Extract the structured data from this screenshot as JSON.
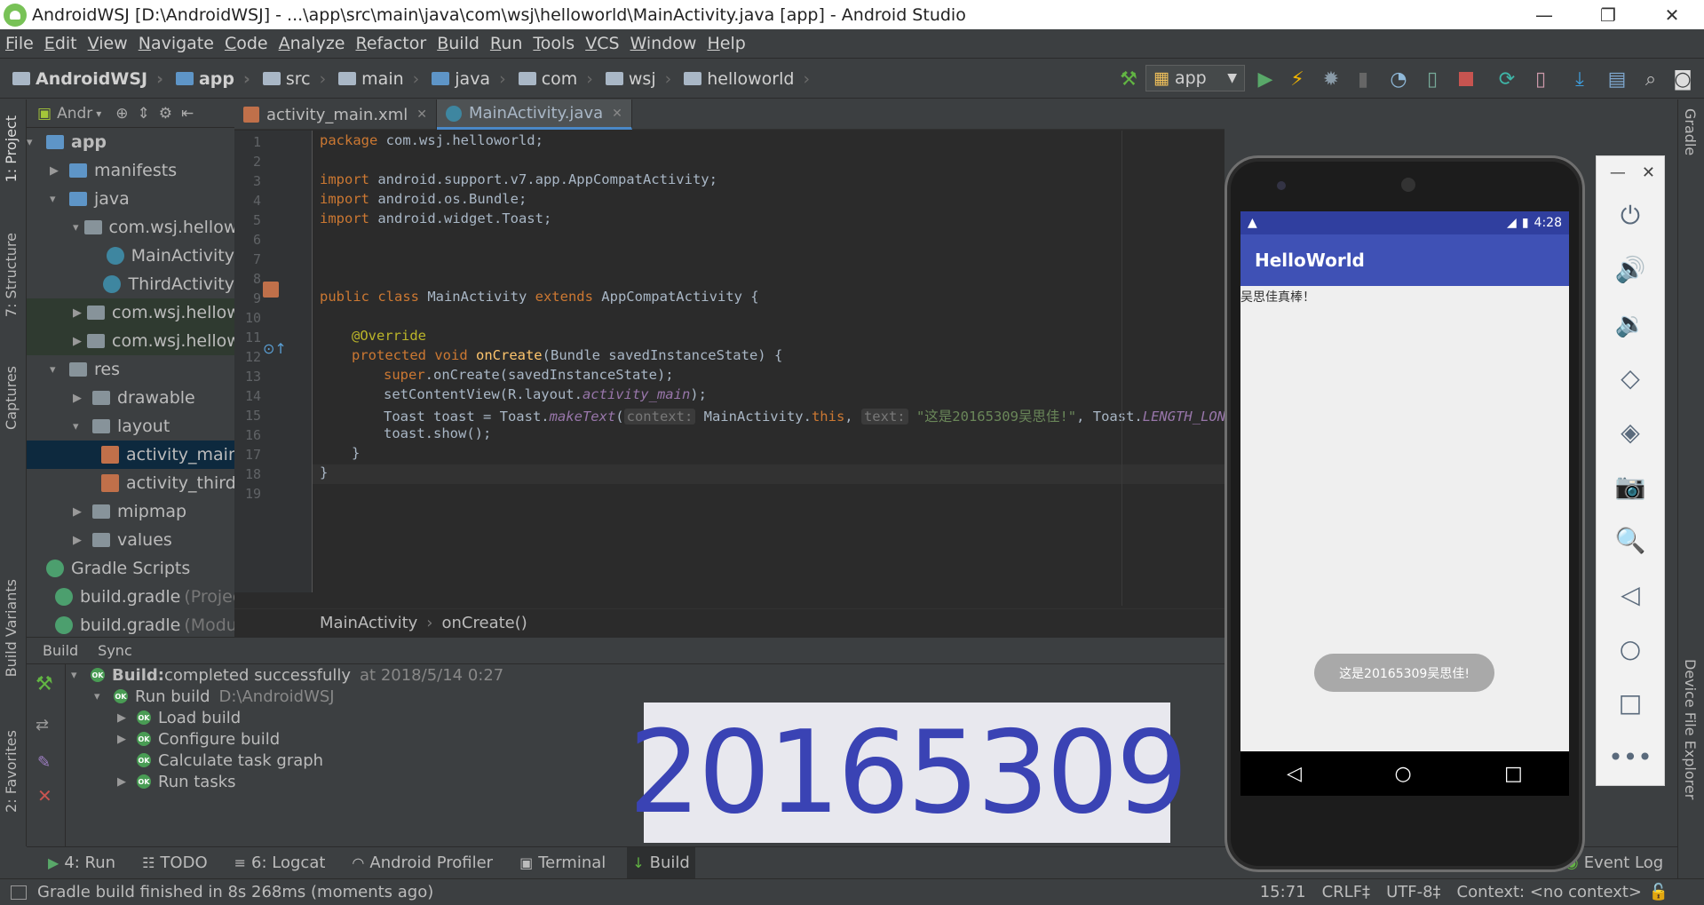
{
  "window": {
    "title": "AndroidWSJ [D:\\AndroidWSJ] - ...\\app\\src\\main\\java\\com\\wsj\\helloworld\\MainActivity.java [app] - Android Studio",
    "controls": [
      "—",
      "❐",
      "✕"
    ]
  },
  "menu": [
    "File",
    "Edit",
    "View",
    "Navigate",
    "Code",
    "Analyze",
    "Refactor",
    "Build",
    "Run",
    "Tools",
    "VCS",
    "Window",
    "Help"
  ],
  "breadcrumb": [
    "AndroidWSJ",
    "app",
    "src",
    "main",
    "java",
    "com",
    "wsj",
    "helloworld"
  ],
  "run_config": "app",
  "project_panel": {
    "header": "Andr",
    "tree": [
      {
        "label": "app",
        "indent": 0,
        "arrow": "▾",
        "icon": "folder-blue",
        "bold": true
      },
      {
        "label": "manifests",
        "indent": 1,
        "arrow": "▶",
        "icon": "folder-blue"
      },
      {
        "label": "java",
        "indent": 1,
        "arrow": "▾",
        "icon": "folder-blue"
      },
      {
        "label": "com.wsj.hellowor",
        "indent": 2,
        "arrow": "▾",
        "icon": "folder"
      },
      {
        "label": "MainActivity",
        "indent": 3,
        "arrow": "",
        "icon": "class"
      },
      {
        "label": "ThirdActivity",
        "indent": 3,
        "arrow": "",
        "icon": "class"
      },
      {
        "label": "com.wsj.hellowor",
        "indent": 2,
        "arrow": "▶",
        "icon": "folder",
        "highlight": true
      },
      {
        "label": "com.wsj.hellowor",
        "indent": 2,
        "arrow": "▶",
        "icon": "folder",
        "highlight": true
      },
      {
        "label": "res",
        "indent": 1,
        "arrow": "▾",
        "icon": "folder"
      },
      {
        "label": "drawable",
        "indent": 2,
        "arrow": "▶",
        "icon": "folder"
      },
      {
        "label": "layout",
        "indent": 2,
        "arrow": "▾",
        "icon": "folder"
      },
      {
        "label": "activity_main.",
        "indent": 3,
        "arrow": "",
        "icon": "xml",
        "selected": true
      },
      {
        "label": "activity_third.",
        "indent": 3,
        "arrow": "",
        "icon": "xml"
      },
      {
        "label": "mipmap",
        "indent": 2,
        "arrow": "▶",
        "icon": "folder"
      },
      {
        "label": "values",
        "indent": 2,
        "arrow": "▶",
        "icon": "folder"
      },
      {
        "label": "Gradle Scripts",
        "indent": 0,
        "arrow": "",
        "icon": "gradle"
      },
      {
        "label": "build.gradle",
        "muted": "(Project",
        "indent": 1,
        "arrow": "",
        "icon": "gradle"
      },
      {
        "label": "build.gradle",
        "muted": "(Module",
        "indent": 1,
        "arrow": "",
        "icon": "gradle"
      }
    ]
  },
  "left_tabs": [
    "1: Project",
    "7: Structure",
    "Captures",
    "Build Variants",
    "2: Favorites"
  ],
  "right_tabs": [
    "Gradle",
    "Device File Explorer"
  ],
  "editor": {
    "tabs": [
      {
        "label": "activity_main.xml",
        "active": false
      },
      {
        "label": "MainActivity.java",
        "active": true
      }
    ],
    "line_numbers": [
      "1",
      "2",
      "3",
      "4",
      "5",
      "6",
      "7",
      "8",
      "9",
      "10",
      "11",
      "12",
      "13",
      "14",
      "15",
      "16",
      "17",
      "18",
      "19"
    ],
    "code": {
      "l1_kw": "package",
      "l1_rest": " com.wsj.helloworld;",
      "l3_kw": "import",
      "l3_rest": " android.support.v7.app.AppCompatActivity;",
      "l4_kw": "import",
      "l4_rest": " android.os.Bundle;",
      "l5_kw": "import",
      "l5_rest": " android.widget.Toast;",
      "l9_kw1": "public class",
      "l9_a": " MainActivity ",
      "l9_kw2": "extends",
      "l9_b": " AppCompatActivity {",
      "l11": "@Override",
      "l12_kw": "protected void",
      "l12_fn": " onCreate",
      "l12_rest": "(Bundle savedInstanceState) {",
      "l13_kw": "super",
      "l13_rest": ".onCreate(savedInstanceState);",
      "l14_a": "setContentView(R.layout.",
      "l14_it": "activity_main",
      "l14_b": ");",
      "l15_a": "Toast toast = Toast.",
      "l15_it": "makeText",
      "l15_b": "(",
      "l15_hint1": "context:",
      "l15_c": " MainActivity.",
      "l15_kw": "this",
      "l15_d": ", ",
      "l15_hint2": "text:",
      "l15_str": " \"这是20165309吴思佳!\"",
      "l15_e": ", Toast.",
      "l15_it2": "LENGTH_LONG",
      "l15_f": ");",
      "l16": "toast.show();",
      "l17": "}",
      "l18": "}"
    },
    "breadcrumb": [
      "MainActivity",
      "onCreate()"
    ]
  },
  "build_panel": {
    "tabs": [
      "Build",
      "Sync"
    ],
    "rows": [
      {
        "label": "Build:",
        "label2": " completed successfully",
        "muted": "at 2018/5/14 0:27",
        "indent": 0,
        "arrow": "▾",
        "bold": true
      },
      {
        "label": "Run build",
        "muted": "D:\\AndroidWSJ",
        "indent": 1,
        "arrow": "▾"
      },
      {
        "label": "Load build",
        "indent": 2,
        "arrow": "▶"
      },
      {
        "label": "Configure build",
        "indent": 2,
        "arrow": "▶"
      },
      {
        "label": "Calculate task graph",
        "indent": 2,
        "arrow": ""
      },
      {
        "label": "Run tasks",
        "indent": 2,
        "arrow": "▶"
      }
    ],
    "ok_badge": "OK"
  },
  "overlay_number": "20165309",
  "tool_tabs": [
    {
      "label": "4: Run",
      "icon": "▶",
      "active": false
    },
    {
      "label": "TODO",
      "icon": "☷",
      "active": false
    },
    {
      "label": "6: Logcat",
      "icon": "≡",
      "active": false
    },
    {
      "label": "Android Profiler",
      "icon": "◠",
      "active": false
    },
    {
      "label": "Terminal",
      "icon": "▣",
      "active": false
    },
    {
      "label": "Build",
      "icon": "↓",
      "active": true
    }
  ],
  "event_log": "Event Log",
  "status": {
    "message": "Gradle build finished in 8s 268ms (moments ago)",
    "position": "15:71",
    "line_sep": "CRLF‡",
    "encoding": "UTF-8‡",
    "context": "Context: <no context>"
  },
  "emulator": {
    "time": "4:28",
    "app_title": "HelloWorld",
    "text": "吴思佳真棒！",
    "toast": "这是20165309吴思佳!",
    "nav": [
      "◁",
      "○",
      "□"
    ],
    "panel_controls": [
      "—",
      "✕"
    ],
    "panel_buttons": [
      "⏻",
      "🔊",
      "🔉",
      "◇",
      "◈",
      "📷",
      "🔍",
      "◁",
      "○",
      "□",
      "•••"
    ]
  },
  "colors": {
    "ide_bg": "#3c3f41",
    "editor_bg": "#2b2b2b",
    "keyword": "#cc7832",
    "app_bar": "#3f51b5",
    "overlay_text": "#3a43b4"
  }
}
